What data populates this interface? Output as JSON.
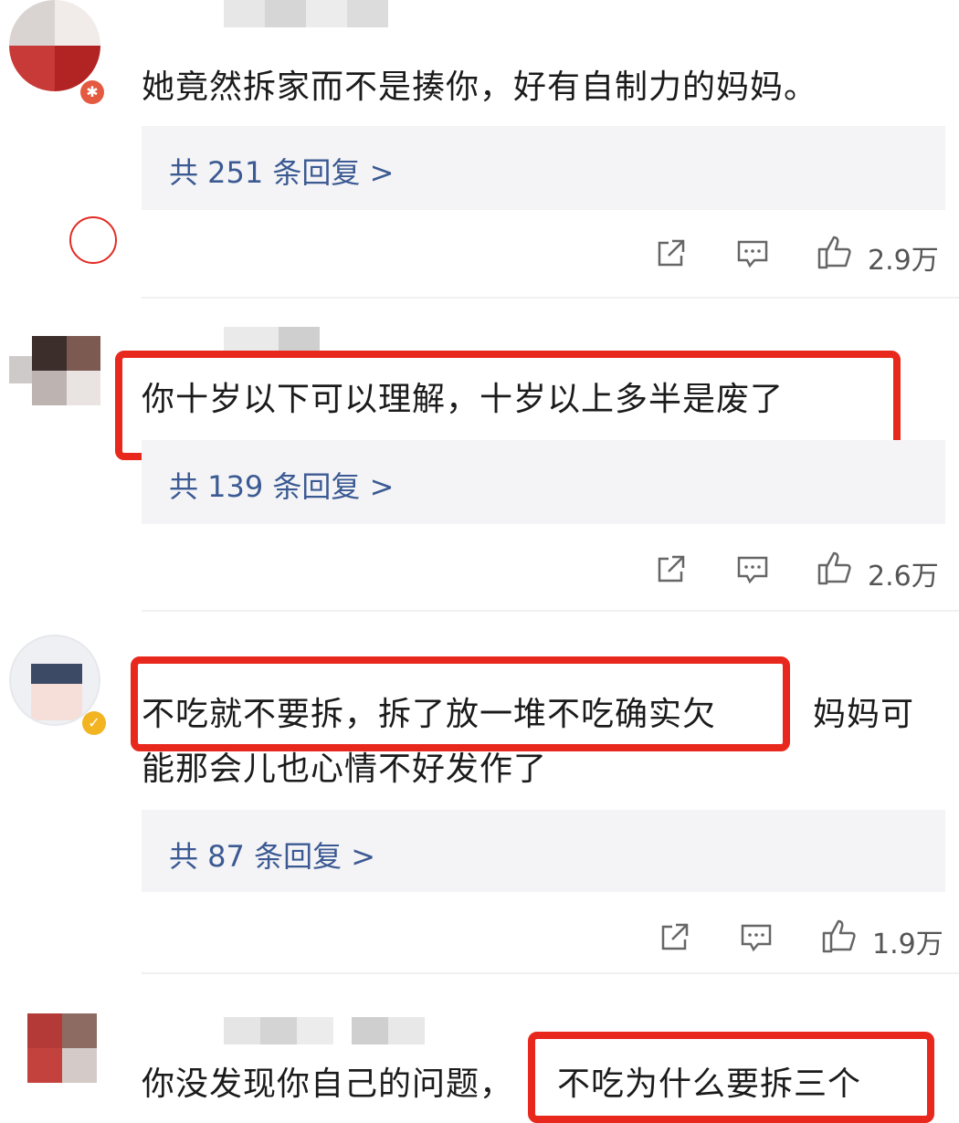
{
  "comments": [
    {
      "text": "她竟然拆家而不是揍你，好有自制力的妈妈。",
      "replies": "共 251 条回复 >",
      "likes": "2.9万"
    },
    {
      "text": "你十岁以下可以理解，十岁以上多半是废了",
      "replies": "共 139 条回复 >",
      "likes": "2.6万"
    },
    {
      "text_line1_highlight": "不吃就不要拆，拆了放一堆不吃确实欠",
      "text_line1_rest": "妈妈可",
      "text_line2": "能那会儿也心情不好发作了",
      "replies": "共 87 条回复 >",
      "likes": "1.9万"
    },
    {
      "text_plain": "你没发现你自己的问题，",
      "text_highlight": "不吃为什么要拆三个"
    }
  ],
  "icons": {
    "share": "share-icon",
    "comment": "comment-icon",
    "like": "thumbs-up-icon"
  },
  "colors": {
    "highlight_frame": "#e8281d",
    "reply_link": "#3b5a93",
    "reply_bg": "#f4f4f6"
  }
}
